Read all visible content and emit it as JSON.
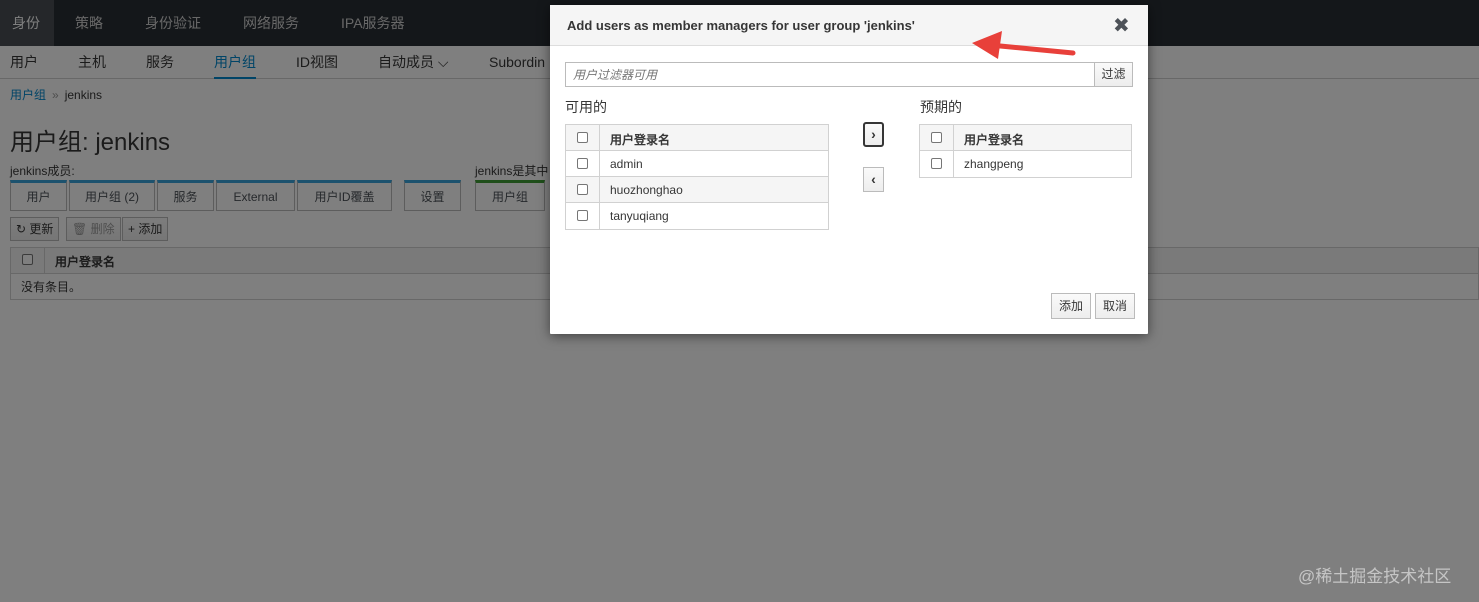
{
  "topnav": {
    "items": [
      "身份",
      "策略",
      "身份验证",
      "网络服务",
      "IPA服务器"
    ]
  },
  "subnav": {
    "items": [
      "用户",
      "主机",
      "服务",
      "用户组",
      "ID视图",
      "自动成员 ⌵",
      "Subordin"
    ]
  },
  "breadcrumb": {
    "link": "用户组",
    "sep": "»",
    "current": "jenkins"
  },
  "page": {
    "title": "用户组: jenkins",
    "members_label": "jenkins成员:",
    "memberof_label": "jenkins是其中",
    "tabs": [
      "用户",
      "用户组 (2)",
      "服务",
      "External",
      "用户ID覆盖",
      "设置",
      "用户组"
    ],
    "actions": {
      "refresh": "↻ 更新",
      "delete": "🗑 删除",
      "add": "+ 添加"
    },
    "table_header": "用户登录名",
    "empty_text": "没有条目。"
  },
  "modal": {
    "title": "Add users as member managers for user group 'jenkins'",
    "close": "✖",
    "filter_placeholder": "用户过滤器可用",
    "filter_button": "过滤",
    "available_label": "可用的",
    "prospective_label": "预期的",
    "column_header": "用户登录名",
    "available": [
      "admin",
      "huozhonghao",
      "tanyuqiang"
    ],
    "prospective": [
      "zhangpeng"
    ],
    "move_right": "›",
    "move_left": "‹",
    "add_button": "添加",
    "cancel_button": "取消"
  },
  "watermark": "@稀土掘金技术社区",
  "colors": {
    "accent": "#0088ce",
    "annotation_arrow": "#e8403a",
    "nav_bg": "#292e34"
  }
}
